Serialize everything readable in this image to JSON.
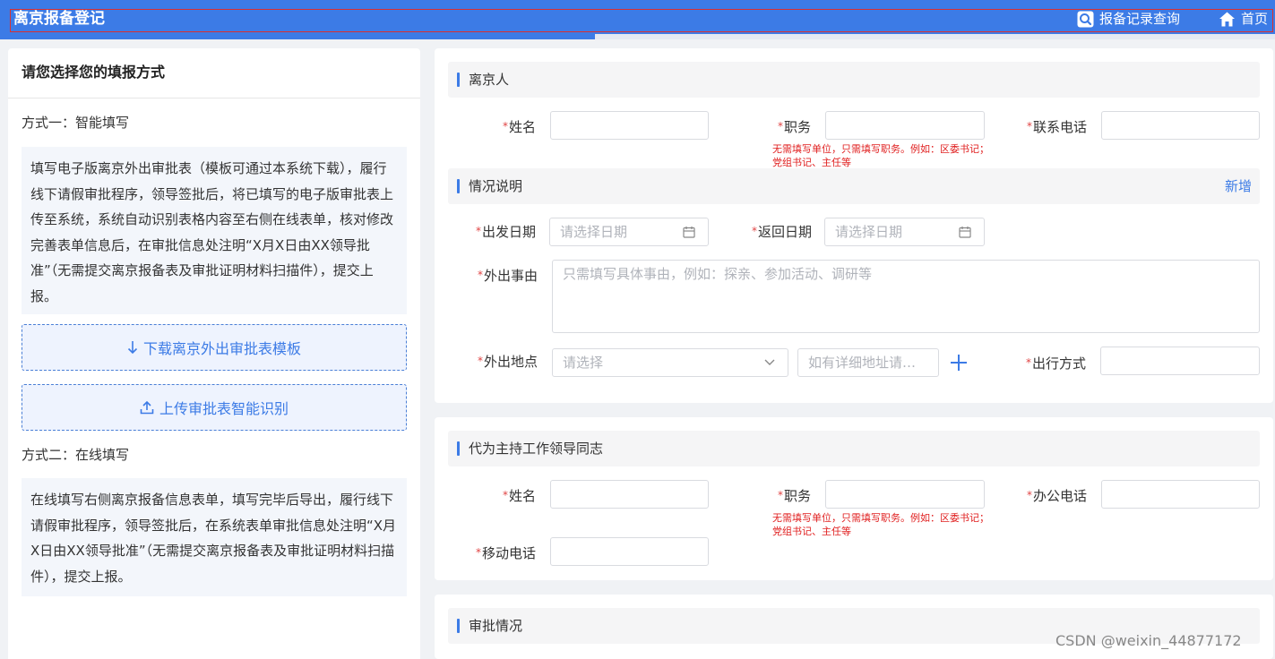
{
  "header": {
    "title": "离京报备登记",
    "record_query": "报备记录查询",
    "home": "首页"
  },
  "left": {
    "heading": "请您选择您的填报方式",
    "method1_title": "方式一：智能填写",
    "method1_desc": "填写电子版离京外出审批表（模板可通过本系统下载），履行线下请假审批程序，领导签批后，将已填写的电子版审批表上传至系统，系统自动识别表格内容至右侧在线表单，核对修改完善表单信息后，在审批信息处注明“X月X日由XX领导批准”（无需提交离京报备表及审批证明材料扫描件），提交上报。",
    "download_btn": "下载离京外出审批表模板",
    "upload_btn": "上传审批表智能识别",
    "method2_title": "方式二：在线填写",
    "method2_desc": "在线填写右侧离京报备信息表单，填写完毕后导出，履行线下请假审批程序，领导签批后，在系统表单审批信息处注明“X月X日由XX领导批准”（无需提交离京报备表及审批证明材料扫描件），提交上报。"
  },
  "person": {
    "section": "离京人",
    "name_label": "姓名",
    "post_label": "职务",
    "phone_label": "联系电话",
    "post_hint": "无需填写单位，只需填写职务。例如：区委书记；党组书记、主任等"
  },
  "situation": {
    "section": "情况说明",
    "add": "新增",
    "depart_label": "出发日期",
    "depart_placeholder": "请选择日期",
    "return_label": "返回日期",
    "return_placeholder": "请选择日期",
    "reason_label": "外出事由",
    "reason_placeholder": "只需填写具体事由，例如：探亲、参加活动、调研等",
    "place_label": "外出地点",
    "place_placeholder": "请选择",
    "address_placeholder": "如有详细地址请…",
    "travel_label": "出行方式"
  },
  "deputy": {
    "section": "代为主持工作领导同志",
    "name_label": "姓名",
    "post_label": "职务",
    "office_phone_label": "办公电话",
    "mobile_label": "移动电话",
    "post_hint": "无需填写单位，只需填写职务。例如：区委书记；党组书记、主任等"
  },
  "approval": {
    "section": "审批情况"
  },
  "watermark": "CSDN @weixin_44877172",
  "colors": {
    "primary": "#3c7be6",
    "required": "#e04343",
    "hint": "#e02020"
  }
}
